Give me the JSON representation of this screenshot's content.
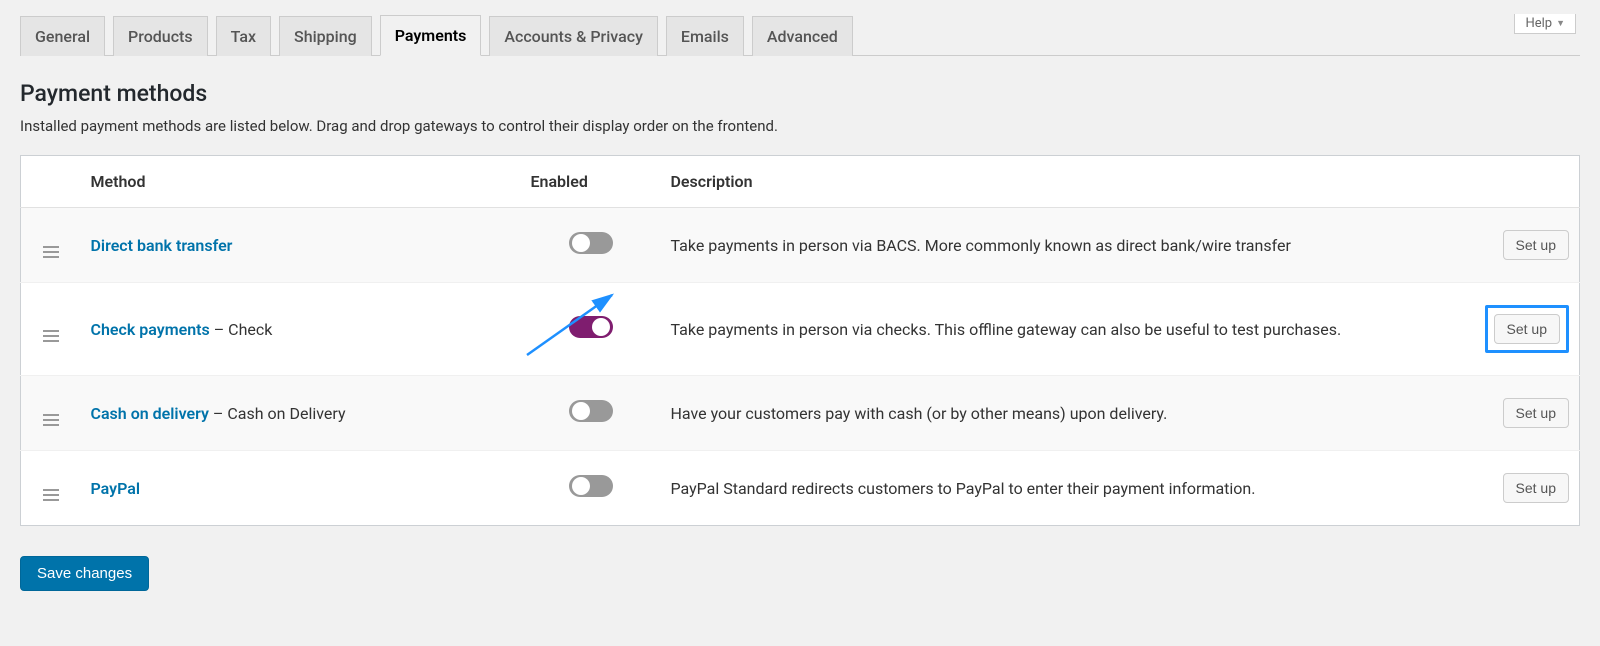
{
  "help_label": "Help",
  "tabs": [
    {
      "label": "General",
      "active": false
    },
    {
      "label": "Products",
      "active": false
    },
    {
      "label": "Tax",
      "active": false
    },
    {
      "label": "Shipping",
      "active": false
    },
    {
      "label": "Payments",
      "active": true
    },
    {
      "label": "Accounts & Privacy",
      "active": false
    },
    {
      "label": "Emails",
      "active": false
    },
    {
      "label": "Advanced",
      "active": false
    }
  ],
  "section_title": "Payment methods",
  "section_desc": "Installed payment methods are listed below. Drag and drop gateways to control their display order on the frontend.",
  "columns": {
    "method": "Method",
    "enabled": "Enabled",
    "description": "Description"
  },
  "rows": [
    {
      "name": "Direct bank transfer",
      "suffix": "",
      "enabled": false,
      "description": "Take payments in person via BACS. More commonly known as direct bank/wire transfer",
      "action": "Set up",
      "highlight": false
    },
    {
      "name": "Check payments",
      "suffix": " – Check",
      "enabled": true,
      "description": "Take payments in person via checks. This offline gateway can also be useful to test purchases.",
      "action": "Set up",
      "highlight": true
    },
    {
      "name": "Cash on delivery",
      "suffix": " – Cash on Delivery",
      "enabled": false,
      "description": "Have your customers pay with cash (or by other means) upon delivery.",
      "action": "Set up",
      "highlight": false
    },
    {
      "name": "PayPal",
      "suffix": "",
      "enabled": false,
      "description": "PayPal Standard redirects customers to PayPal to enter their payment information.",
      "action": "Set up",
      "highlight": false
    }
  ],
  "save_button": "Save changes",
  "colors": {
    "link": "#0073aa",
    "toggle_on": "#7f1d6f",
    "highlight": "#1e90ff"
  }
}
